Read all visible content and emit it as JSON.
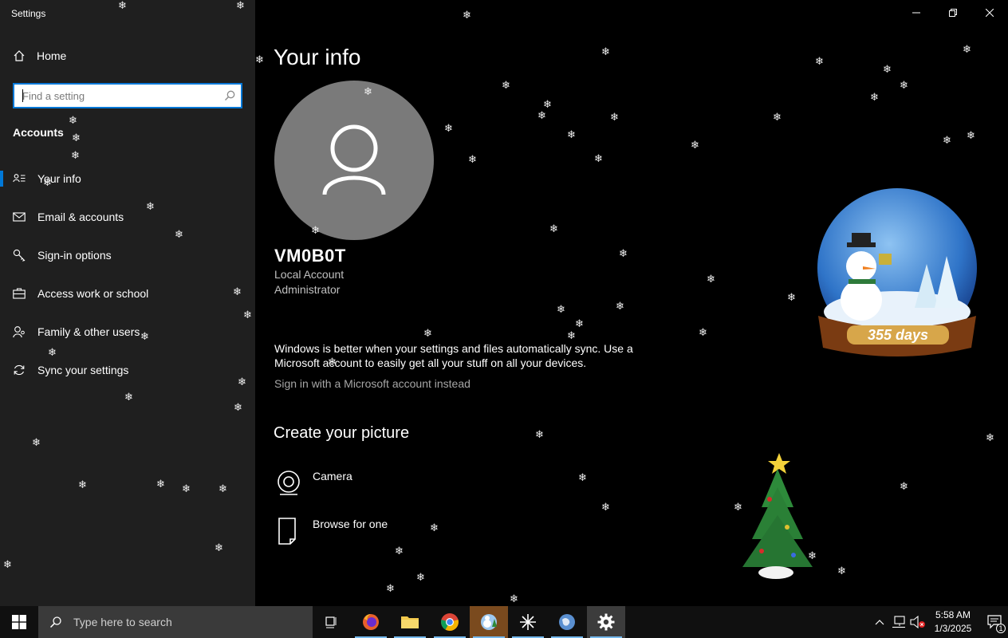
{
  "window": {
    "title": "Settings"
  },
  "sidebar": {
    "home_label": "Home",
    "search_placeholder": "Find a setting",
    "section_label": "Accounts",
    "items": [
      {
        "label": "Your info",
        "icon": "your-info-icon"
      },
      {
        "label": "Email & accounts",
        "icon": "mail-icon"
      },
      {
        "label": "Sign-in options",
        "icon": "key-icon"
      },
      {
        "label": "Access work or school",
        "icon": "briefcase-icon"
      },
      {
        "label": "Family & other users",
        "icon": "family-icon"
      },
      {
        "label": "Sync your settings",
        "icon": "sync-icon"
      }
    ],
    "selected_index": 0
  },
  "main": {
    "title": "Your info",
    "user": {
      "name": "VM0B0T",
      "account_type": "Local Account",
      "role": "Administrator"
    },
    "sync_message": "Windows is better when your settings and files automatically sync. Use a Microsoft account to easily get all your stuff on all your devices.",
    "signin_link": "Sign in with a Microsoft account instead",
    "create_picture_title": "Create your picture",
    "picture_options": [
      {
        "label": "Camera",
        "icon": "camera-icon"
      },
      {
        "label": "Browse for one",
        "icon": "file-icon"
      }
    ]
  },
  "decorations": {
    "snowglobe_label": "355 days"
  },
  "taskbar": {
    "search_placeholder": "Type here to search",
    "apps": [
      {
        "name": "task-view",
        "icon": "task-view-icon",
        "running": false
      },
      {
        "name": "firefox",
        "icon": "firefox-icon",
        "running": true
      },
      {
        "name": "file-explorer",
        "icon": "folder-icon",
        "running": true
      },
      {
        "name": "chrome",
        "icon": "chrome-icon",
        "running": true
      },
      {
        "name": "desktop-snow",
        "icon": "snow-app-icon",
        "running": true
      },
      {
        "name": "unknown-app",
        "icon": "asterisk-icon",
        "running": true
      },
      {
        "name": "globe-app",
        "icon": "globe-icon",
        "running": true
      },
      {
        "name": "settings",
        "icon": "gear-icon",
        "running": true,
        "active": true
      }
    ],
    "time": "5:58 AM",
    "date": "1/3/2025",
    "notification_count": "1"
  },
  "colors": {
    "accent": "#0078d7",
    "sidebar_bg": "#1f1f1f",
    "content_bg": "#000000",
    "avatar_bg": "#7a7a7a"
  }
}
